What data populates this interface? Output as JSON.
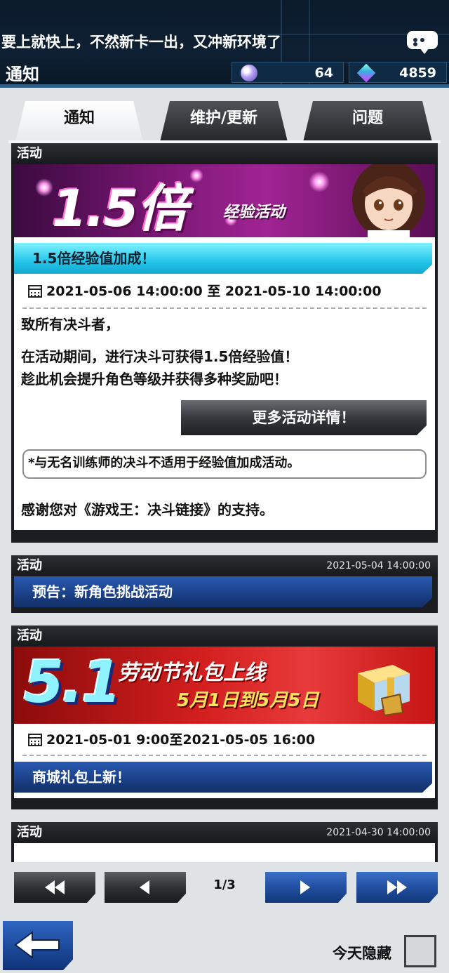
{
  "header": {
    "ticker": "要上就快上，不然新卡一出，又冲新环境了",
    "title": "通知",
    "currency_orb": "64",
    "currency_gem": "4859"
  },
  "tabs": [
    {
      "label": "通知",
      "active": true
    },
    {
      "label": "维护/更新",
      "active": false
    },
    {
      "label": "问题",
      "active": false
    }
  ],
  "notices": [
    {
      "category": "活动",
      "banner": {
        "big": "1.5倍",
        "sub": "经验活动"
      },
      "ribbon": "1.5倍经验值加成！",
      "date_range": "2021-05-06 14:00:00 至 2021-05-10 14:00:00",
      "greeting": "致所有决斗者，",
      "body_line1": "在活动期间，进行决斗可获得1.5倍经验值！",
      "body_line2": "趁此机会提升角色等级并获得多种奖励吧！",
      "detail_button": "更多活动详情！",
      "note": "*与无名训练师的决斗不适用于经验值加成活动。",
      "thanks": "感谢您对《游戏王：决斗链接》的支持。"
    },
    {
      "category": "活动",
      "date": "2021-05-04 14:00:00",
      "ribbon": "预告：新角色挑战活动"
    },
    {
      "category": "活动",
      "banner": {
        "big": "5.1",
        "title": "劳动节礼包上线",
        "sub": "5月1日到5月5日"
      },
      "date_range": "2021-05-01 9:00至2021-05-05 16:00",
      "ribbon": "商城礼包上新！"
    },
    {
      "category": "活动",
      "date": "2021-04-30 14:00:00"
    }
  ],
  "pager": {
    "page": "1/3"
  },
  "footer": {
    "hide_today": "今天隐藏"
  },
  "icons": {
    "chat": "speech-bubble-icon",
    "orb": "orb-currency-icon",
    "gem": "gem-currency-icon",
    "calendar": "calendar-icon",
    "first": "double-left-arrow-icon",
    "prev": "left-arrow-icon",
    "next": "right-arrow-icon",
    "last": "double-right-arrow-icon",
    "back": "back-arrow-icon"
  },
  "colors": {
    "accent_blue": "#1f4c9c",
    "ribbon_cyan": "#24c6ea",
    "header_bg": "#0e2033"
  }
}
